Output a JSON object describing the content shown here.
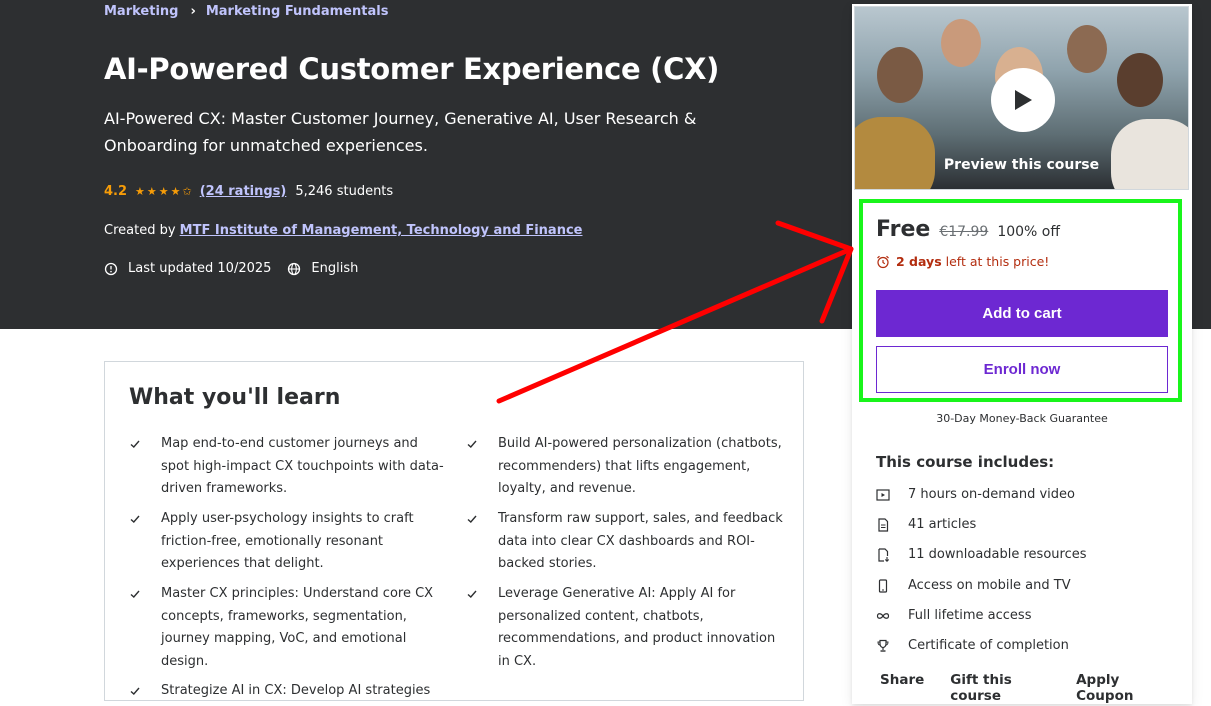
{
  "breadcrumb": {
    "item1": "Marketing",
    "item2": "Marketing Fundamentals"
  },
  "course": {
    "title": "AI-Powered Customer Experience (CX)",
    "subtitle": "AI-Powered CX: Master Customer Journey, Generative AI, User Research & Onboarding for unmatched experiences.",
    "rating": "4.2",
    "stars": "★★★★✩",
    "ratings_link": "(24 ratings)",
    "students": "5,246 students",
    "created_prefix": "Created by",
    "author": "MTF Institute of Management, Technology and Finance",
    "last_updated": "Last updated 10/2025",
    "language": "English"
  },
  "learn": {
    "title": "What you'll learn",
    "items": [
      "Map end-to-end customer journeys and spot high-impact CX touchpoints with data-driven frameworks.",
      "Build AI-powered personalization (chatbots, recommenders) that lifts engagement, loyalty, and revenue.",
      "Apply user-psychology insights to craft friction-free, emotionally resonant experiences that delight.",
      "Transform raw support, sales, and feedback data into clear CX dashboards and ROI-backed stories.",
      "Master CX principles: Understand core CX concepts, frameworks, segmentation, journey mapping, VoC, and emotional design.",
      "Leverage Generative AI: Apply AI for personalized content, chatbots, recommendations, and product innovation in CX.",
      "Strategize AI in CX: Develop AI strategies"
    ]
  },
  "sidebar": {
    "preview_label": "Preview this course",
    "price": "Free",
    "old_price": "€17.99",
    "discount": "100% off",
    "timer_bold": "2 days",
    "timer_rest": "left at this price!",
    "add_to_cart": "Add to cart",
    "enroll": "Enroll now",
    "guarantee": "30-Day Money-Back Guarantee",
    "includes_title": "This course includes:",
    "includes": [
      "7 hours on-demand video",
      "41 articles",
      "11 downloadable resources",
      "Access on mobile and TV",
      "Full lifetime access",
      "Certificate of completion"
    ],
    "share": "Share",
    "gift": "Gift this course",
    "coupon": "Apply Coupon"
  },
  "colors": {
    "hero_bg": "#2d2f31",
    "link": "#c0c4fc",
    "star": "#f69c08",
    "purple": "#6d28d2",
    "timer": "#b32d0f",
    "highlight": "#19f51b",
    "arrow": "#ff0000"
  }
}
